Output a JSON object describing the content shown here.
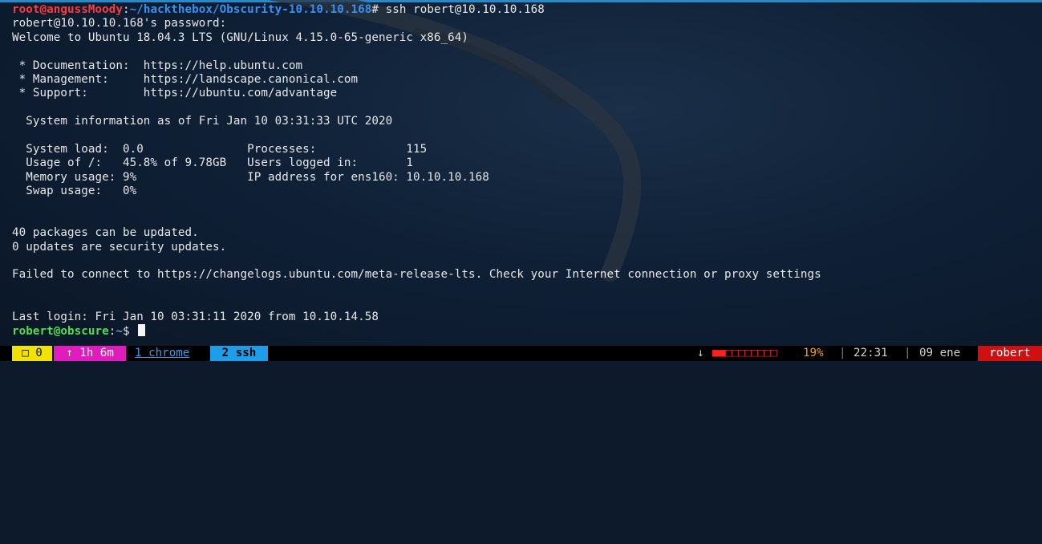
{
  "terminal": {
    "prompt1": {
      "user_host": "root@angussMoody",
      "sep": ":",
      "path": "~/hackthebox/Obscurity-10.10.10.168",
      "symbol": "# ",
      "command": "ssh robert@10.10.10.168"
    },
    "lines": {
      "password": "robert@10.10.10.168's password:",
      "welcome": "Welcome to Ubuntu 18.04.3 LTS (GNU/Linux 4.15.0-65-generic x86_64)",
      "blank1": "",
      "doc": " * Documentation:  https://help.ubuntu.com",
      "mgmt": " * Management:     https://landscape.canonical.com",
      "support": " * Support:        https://ubuntu.com/advantage",
      "blank2": "",
      "sysinfo": "  System information as of Fri Jan 10 03:31:33 UTC 2020",
      "blank3": "",
      "load": "  System load:  0.0               Processes:             115",
      "usage": "  Usage of /:   45.8% of 9.78GB   Users logged in:       1",
      "memory": "  Memory usage: 9%                IP address for ens160: 10.10.10.168",
      "swap": "  Swap usage:   0%",
      "blank4": "",
      "blank5": "",
      "packages": "40 packages can be updated.",
      "security": "0 updates are security updates.",
      "blank6": "",
      "failed": "Failed to connect to https://changelogs.ubuntu.com/meta-release-lts. Check your Internet connection or proxy settings",
      "blank7": "",
      "blank8": "",
      "lastlogin": "Last login: Fri Jan 10 03:31:11 2020 from 10.10.14.58"
    },
    "prompt2": {
      "user_host": "robert@obscure",
      "sep": ":",
      "path": "~",
      "symbol": "$ "
    }
  },
  "statusbar": {
    "session": "□ 0",
    "uptime": "↑ 1h 6m",
    "window1": "1 chrome",
    "window2": "2 ssh",
    "down_arrow": "↓",
    "meter_filled": "■■",
    "meter_empty": "□□□□□□□□",
    "percent": "19%",
    "sep": "|",
    "time": "22:31",
    "date": "09 ene",
    "user": "robert"
  },
  "colors": {
    "background": "#0c1a2c",
    "root_prompt": "#ff3b3b",
    "path": "#3b8ff0",
    "user_prompt": "#4fe04f",
    "session_bg": "#f2e200",
    "uptime_bg": "#e21bbd",
    "active_window_bg": "#1e9ee8",
    "user_bg": "#d01010"
  }
}
